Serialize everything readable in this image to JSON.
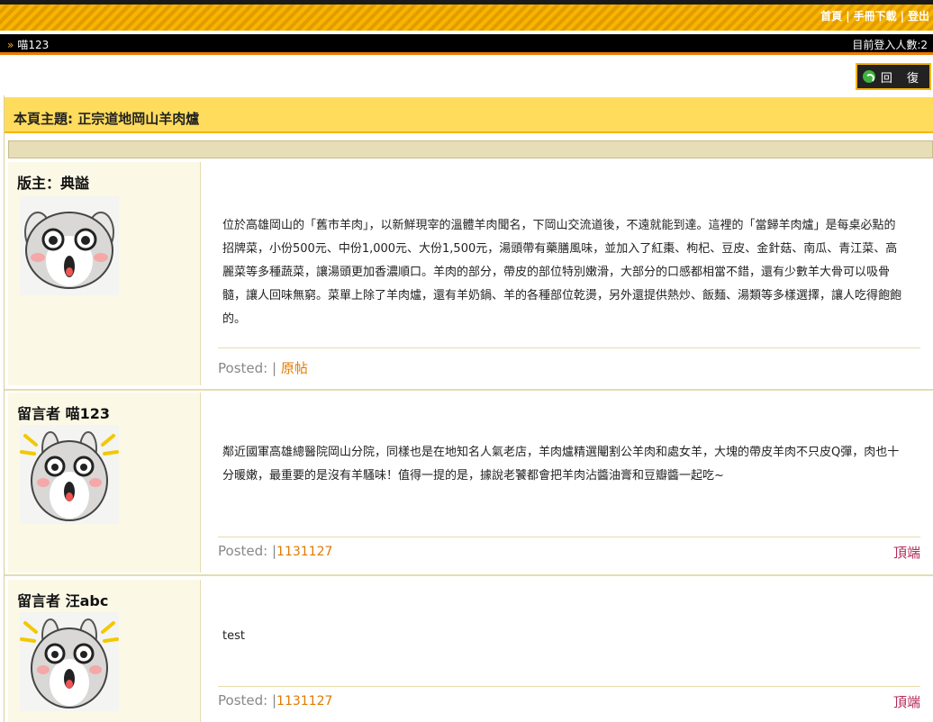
{
  "header": {
    "links": [
      "首頁",
      "手冊下載",
      "登出"
    ],
    "separator": "|",
    "breadcrumb": "喵123",
    "breadcrumb_arrow": "»",
    "online": "目前登入人數:2"
  },
  "reply_button": {
    "label": "回 復"
  },
  "topic": {
    "title": "本頁主題: 正宗道地岡山羊肉爐"
  },
  "posts": [
    {
      "author": "版主：典謚",
      "avatar": "bunny-avatar",
      "body": "位於高雄岡山的「舊市羊肉」，以新鮮現宰的溫體羊肉聞名，下岡山交流道後，不遠就能到達。這裡的「當歸羊肉爐」是每桌必點的招牌菜，小份500元、中份1,000元、大份1,500元，湯頭帶有藥膳風味，並加入了紅棗、枸杞、豆皮、金針菇、南瓜、青江菜、高麗菜等多種蔬菜，讓湯頭更加香濃順口。羊肉的部分，帶皮的部位特別嫩滑，大部分的口感都相當不錯，還有少數羊大骨可以吸骨髓，讓人回味無窮。菜單上除了羊肉爐，還有羊奶鍋、羊的各種部位乾燙，另外還提供熱炒、飯麵、湯類等多樣選擇，讓人吃得飽飽的。",
      "posted_label": "Posted:",
      "sep": "|",
      "link": "原帖"
    },
    {
      "author": "留言者 喵123",
      "avatar": "bunny-surprised-avatar",
      "body": "鄰近國軍高雄總醫院岡山分院，同樣也是在地知名人氣老店，羊肉爐精選閹割公羊肉和處女羊，大塊的帶皮羊肉不只皮Q彈，肉也十分暖嫩，最重要的是沒有羊騷味！值得一提的是，據說老饕都會把羊肉沾醬油膏和豆瓣醬一起吃~",
      "posted_label": "Posted:",
      "sep": "|",
      "date": "1131127",
      "top": "頂端"
    },
    {
      "author": "留言者 汪abc",
      "avatar": "bunny-surprised-avatar",
      "body": "test",
      "posted_label": "Posted:",
      "sep": "|",
      "date": "1131127",
      "top": "頂端"
    }
  ],
  "colors": {
    "accent": "#f7b500",
    "bar": "#000000",
    "link": "#e07a00",
    "top_link": "#b5295a",
    "topic_bg": "#ffdc5c"
  }
}
